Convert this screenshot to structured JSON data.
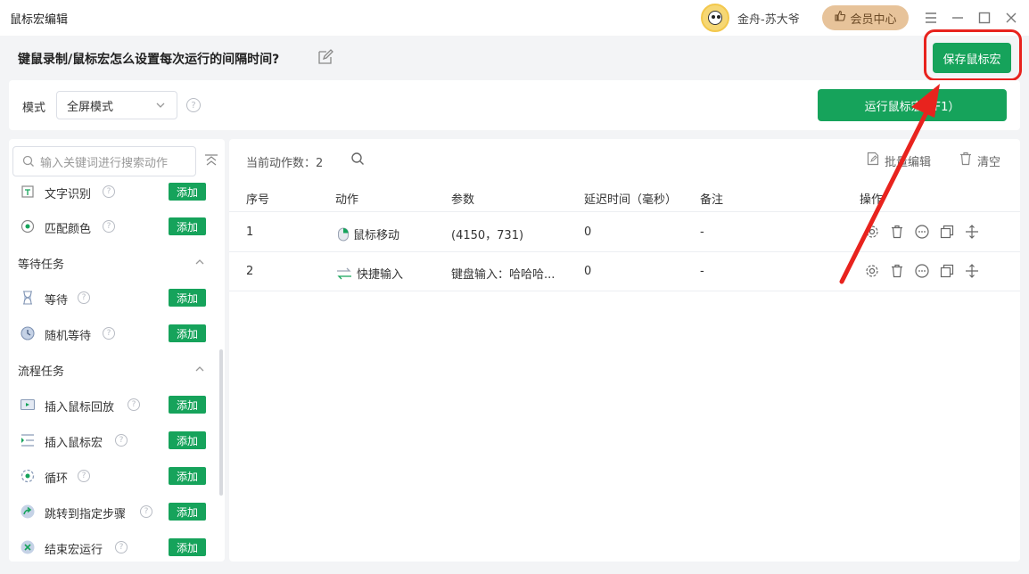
{
  "app": {
    "title": "鼠标宏编辑",
    "username": "金舟-苏大爷",
    "vip_label": "会员中心"
  },
  "header": {
    "doc_title": "键鼠录制/鼠标宏怎么设置每次运行的间隔时间?",
    "save_label": "保存鼠标宏"
  },
  "mode": {
    "label": "模式",
    "selected": "全屏模式",
    "run_label": "运行鼠标宏（F1）"
  },
  "sidebar": {
    "search_placeholder": "输入关键词进行搜索动作",
    "add_label": "添加",
    "items_top": [
      {
        "label": "文字识别",
        "icon": "text-recognition-icon"
      },
      {
        "label": "匹配颜色",
        "icon": "color-match-icon"
      }
    ],
    "groups": [
      {
        "title": "等待任务",
        "items": [
          {
            "label": "等待",
            "icon": "hourglass-icon"
          },
          {
            "label": "随机等待",
            "icon": "clock-icon"
          }
        ]
      },
      {
        "title": "流程任务",
        "items": [
          {
            "label": "插入鼠标回放",
            "icon": "replay-icon"
          },
          {
            "label": "插入鼠标宏",
            "icon": "insert-macro-icon"
          },
          {
            "label": "循环",
            "icon": "loop-icon"
          },
          {
            "label": "跳转到指定步骤",
            "icon": "jump-icon"
          },
          {
            "label": "结束宏运行",
            "icon": "stop-icon"
          }
        ]
      }
    ]
  },
  "main": {
    "count_label": "当前动作数：2",
    "batch_label": "批量编辑",
    "clear_label": "清空",
    "columns": [
      "序号",
      "动作",
      "参数",
      "延迟时间（毫秒）",
      "备注",
      "操作"
    ],
    "rows": [
      {
        "index": "1",
        "action": "鼠标移动",
        "param": "(4150，731)",
        "delay": "0",
        "note": "-"
      },
      {
        "index": "2",
        "action": "快捷输入",
        "param": "键盘输入：哈哈哈...",
        "delay": "0",
        "note": "-"
      }
    ]
  },
  "colors": {
    "accent_green": "#16a35b",
    "highlight_red": "#e8231e",
    "vip_gold": "#e7c39a"
  }
}
